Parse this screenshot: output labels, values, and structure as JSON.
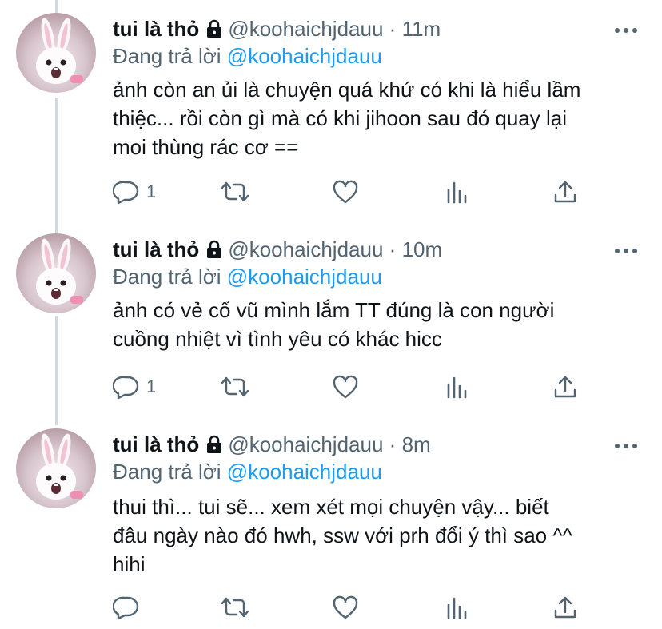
{
  "colors": {
    "accent": "#1d9bf0",
    "secondary": "#536471",
    "text": "#0f1419",
    "thread_line": "#cfd9de"
  },
  "icons": {
    "lock": "lock-icon",
    "more": "more-icon",
    "reply": "reply-icon",
    "retweet": "retweet-icon",
    "like": "like-icon",
    "views": "views-icon",
    "share": "share-icon"
  },
  "tweets": [
    {
      "name": "tui là thỏ",
      "handle": "@koohaichjdauu",
      "dot": "·",
      "time": "11m",
      "replying_prefix": "Đang trả lời",
      "replying_to": "@koohaichjdauu",
      "lines": [
        "ảnh còn an ủi là chuyện quá khứ có khi là hiểu lầm",
        "thiệc... rồi còn gì mà có khi jihoon sau đó quay lại",
        "moi thùng rác cơ =="
      ],
      "reply_count": "1"
    },
    {
      "name": "tui là thỏ",
      "handle": "@koohaichjdauu",
      "dot": "·",
      "time": "10m",
      "replying_prefix": "Đang trả lời",
      "replying_to": "@koohaichjdauu",
      "lines": [
        "ảnh có vẻ cổ vũ mình lắm TT đúng là con người",
        "cuồng nhiệt vì tình yêu có khác hicc"
      ],
      "reply_count": "1"
    },
    {
      "name": "tui là thỏ",
      "handle": "@koohaichjdauu",
      "dot": "·",
      "time": "8m",
      "replying_prefix": "Đang trả lời",
      "replying_to": "@koohaichjdauu",
      "lines": [
        "thui thì... tui sẽ... xem xét mọi chuyện vậy... biết",
        "đâu ngày nào đó hwh, ssw với prh đổi ý thì sao ^^",
        "hihi"
      ],
      "reply_count": ""
    }
  ]
}
